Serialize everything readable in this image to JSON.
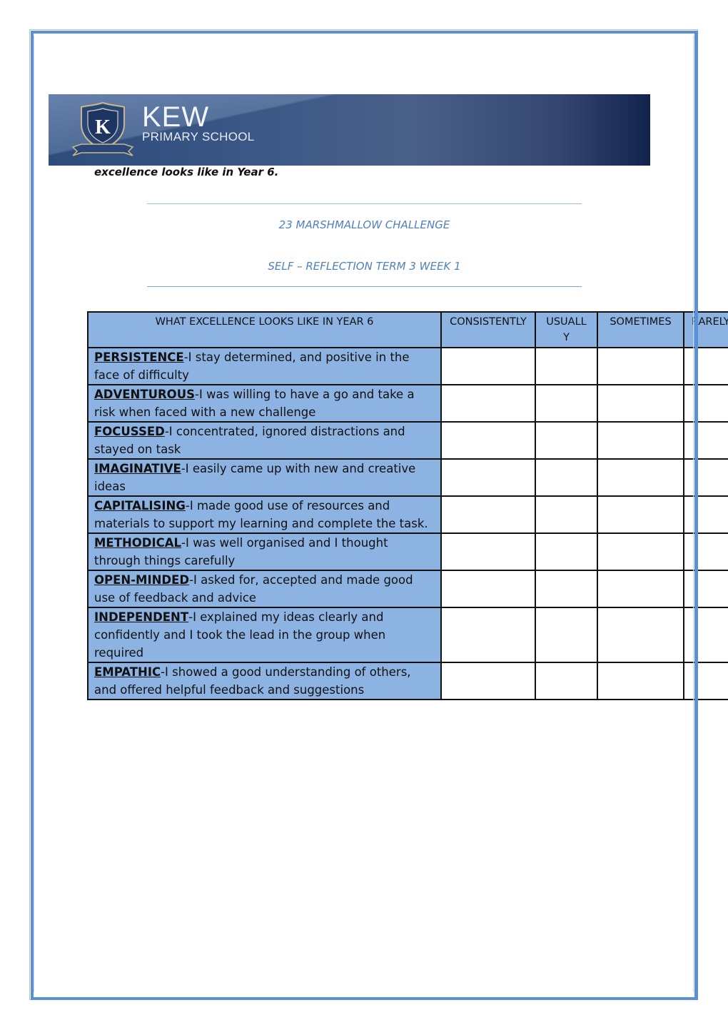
{
  "banner": {
    "school_name": "KEW",
    "school_subtitle": "PRIMARY SCHOOL",
    "crest_letter": "K",
    "colors": {
      "banner_dark": "#13244c",
      "banner_mid": "#3b5886",
      "crest_gold": "#c9b98a"
    }
  },
  "lead_text": "excellence looks like in Year 6.",
  "titles": {
    "line1": "23 MARSHMALLOW CHALLENGE",
    "line2": "SELF – REFLECTION TERM 3 WEEK 1",
    "color": "#4f81bd"
  },
  "table": {
    "headers": [
      "WHAT EXCELLENCE LOOKS LIKE IN YEAR 6",
      "CONSISTENTLY",
      "USUALLY",
      "SOMETIMES",
      "RARELY"
    ],
    "header_color": "#8db3e2",
    "rows": [
      {
        "keyword": "PERSISTENCE",
        "text": "-I stay determined, and positive in the face of difficulty"
      },
      {
        "keyword": "ADVENTUROUS",
        "text": "-I was willing to have a go and take a risk when faced with a new challenge"
      },
      {
        "keyword": "FOCUSSED",
        "text": "-I concentrated, ignored distractions and stayed on task"
      },
      {
        "keyword": "IMAGINATIVE",
        "text": "-I easily came up with new and creative ideas"
      },
      {
        "keyword": "CAPITALISING",
        "text": "-I made good use of resources and materials to support my learning and complete the task."
      },
      {
        "keyword": "METHODICAL",
        "text": "-I was well organised and I thought through things carefully"
      },
      {
        "keyword": "OPEN-MINDED",
        "text": "-I asked for, accepted and made good use of feedback and advice"
      },
      {
        "keyword": "INDEPENDENT",
        "text": "-I explained my ideas clearly and confidently and I took the lead in the group when required"
      },
      {
        "keyword": "EMPATHIC",
        "text": "-I showed a good understanding of others, and offered helpful feedback and suggestions"
      }
    ]
  }
}
